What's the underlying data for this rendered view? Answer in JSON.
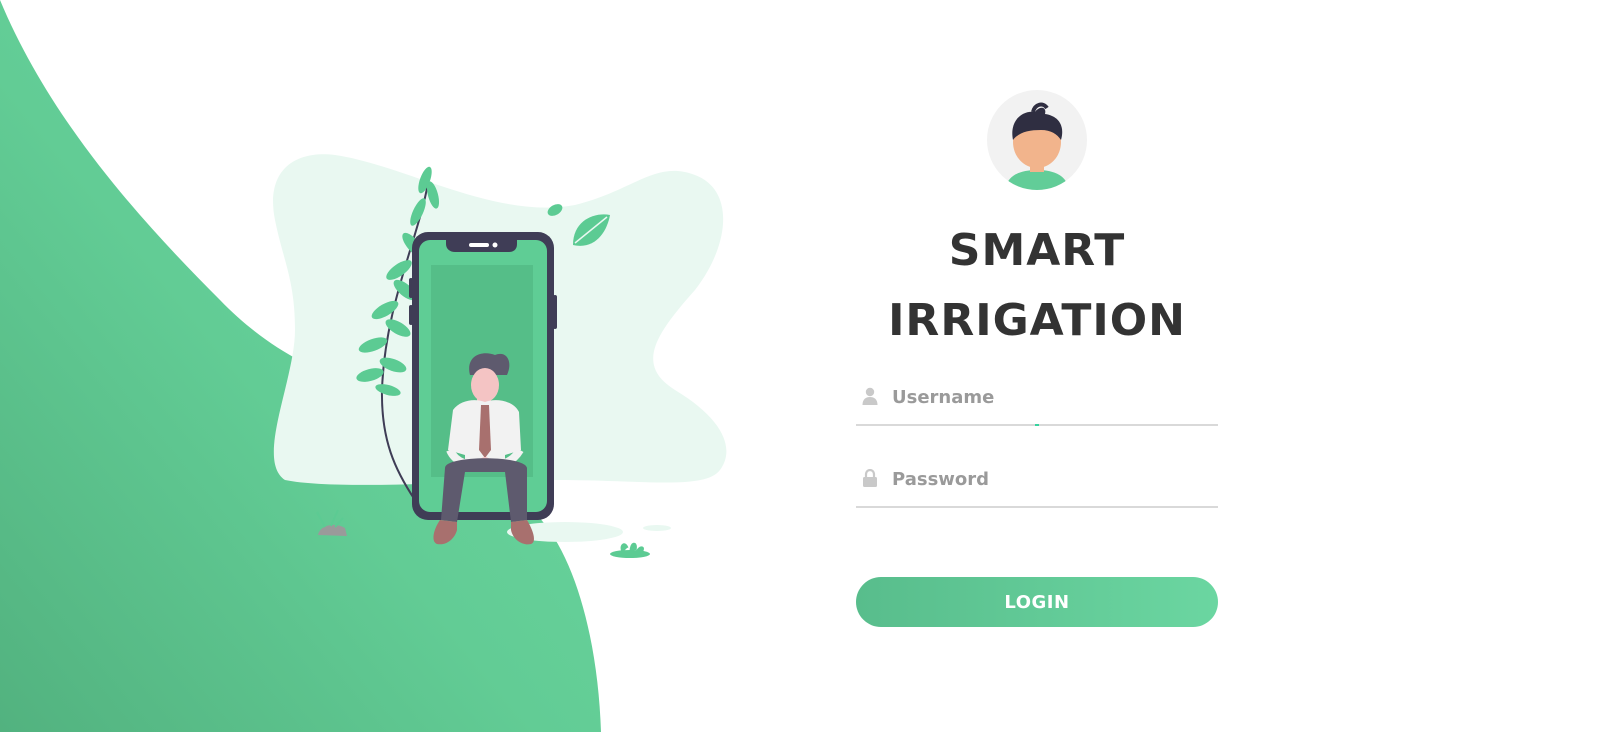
{
  "app": {
    "title_line1": "SMART",
    "title_line2": "IRRIGATION"
  },
  "form": {
    "username_placeholder": "Username",
    "username_value": "",
    "password_placeholder": "Password",
    "password_value": "",
    "login_label": "LOGIN"
  },
  "icons": {
    "username": "user-icon",
    "password": "lock-icon",
    "avatar": "avatar-icon"
  },
  "colors": {
    "brand_green": "#62cd98",
    "button_start": "#58bd8c",
    "button_end": "#6bd6a1",
    "title": "#333333",
    "placeholder": "#9a9a9a",
    "phone_frame": "#3f3d56"
  }
}
